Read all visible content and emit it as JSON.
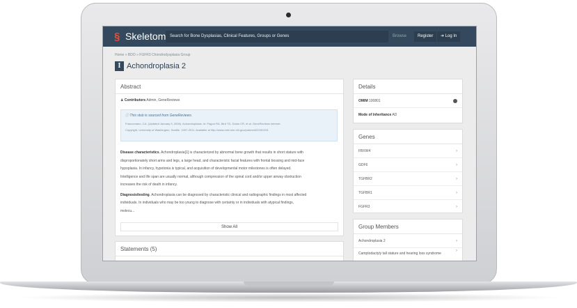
{
  "nav": {
    "logo": "Skeletome",
    "search_placeholder": "Search for Bone Dysplasias, Clinical Features, Groups or Genes",
    "browse": "Browse",
    "register": "Register",
    "login": "Log In"
  },
  "breadcrumb": "Home » BDO » FGFR3 Chondrodysplasia Group",
  "page": {
    "badge": "I",
    "title": "Achondroplasia 2"
  },
  "abstract": {
    "heading": "Abstract",
    "contributors_label": "Contributors",
    "contributors": "Admin, GeneReviews",
    "notice_title": "This stub is sourced from GeneReviews.",
    "notice_line1": "Francomano, CA. (Updated January 9, 2006). Achondroplasia. In: Pagon RA, Bird TD, Dolan CR, et al. GeneReviews Internet.",
    "notice_line2": "Copyright, University of Washington, Seattle. 1997-2011. Available at http://www.ncbi.nlm.nih.gov/pubmed/20301331",
    "p1_label": "Disease characteristics",
    "p1_line1": ". Achondroplasia[1] is characterized by abnormal bone growth that results in short stature with",
    "p1_line2": "disproportionately short arms and legs, a large head, and characteristic facial features with frontal bossing and mid-face",
    "p1_line3": "hypoplasia. In infancy, hypotonia is typical, and acquisition of developmental motor milestones is often delayed.",
    "p1_line4": "Intelligence and life span are usually normal, although compression of the spinal cord and/or upper airway obstruction",
    "p1_line5": "increases the risk of death in infancy.",
    "p2_label": "Diagnosis/testing",
    "p2_line1": ". Achondroplasia can be diagnosed by characteristic clinical and radiographic findings in most affected",
    "p2_line2": "individuals. In individuals who may be too young to diagnose with certainty or in individuals with atypical findings,",
    "p2_line3": "molecu...",
    "show_all": "Show All"
  },
  "statements": {
    "heading": "Statements (5)"
  },
  "details": {
    "heading": "Details",
    "omim_label": "OMIM",
    "omim_value": "100801",
    "moi_label": "Mode of Inheritance",
    "moi_value": "AD"
  },
  "genes": {
    "heading": "Genes",
    "items": [
      "FBXW4",
      "GDF6",
      "TGFBR2",
      "TGFBR1",
      "FGFR3"
    ]
  },
  "group_members": {
    "heading": "Group Members",
    "items": [
      "Achondroplasia 2",
      "Camptodactyly tall stature and hearing loss syndrome"
    ]
  },
  "colors": {
    "navbar": "#34495e",
    "logo_accent": "#e74c3c",
    "notice_bg": "#eaf2f9"
  }
}
